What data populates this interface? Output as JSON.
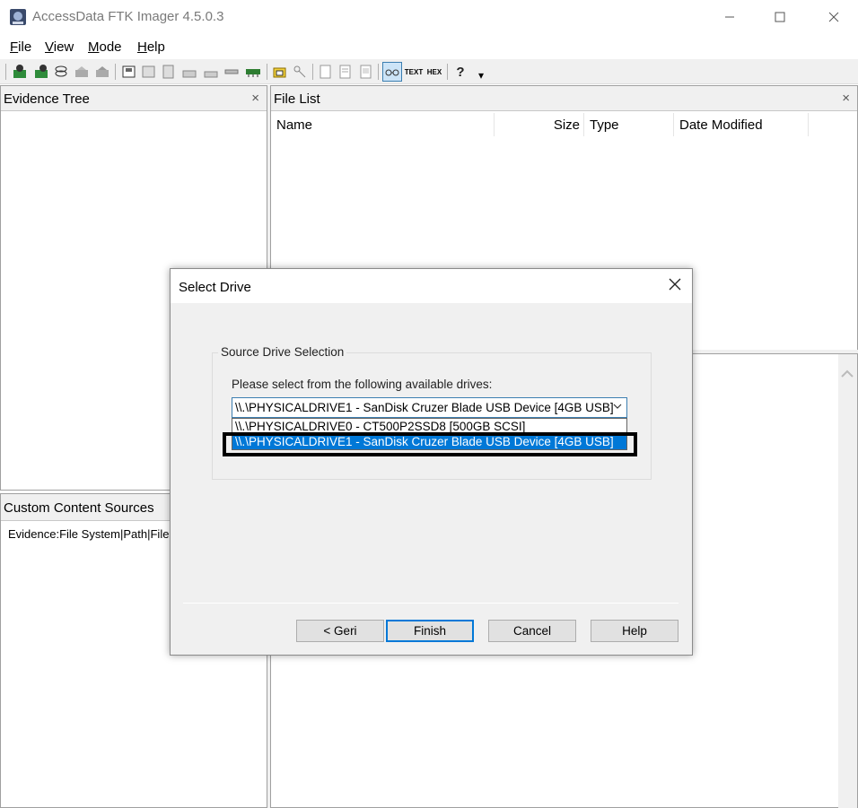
{
  "window": {
    "title": "AccessData FTK Imager 4.5.0.3",
    "minimize": "—",
    "maximize": "☐",
    "close": "✕"
  },
  "menu": [
    {
      "underline": "F",
      "rest": "ile"
    },
    {
      "underline": "V",
      "rest": "iew"
    },
    {
      "underline": "M",
      "rest": "ode"
    },
    {
      "underline": "H",
      "rest": "elp"
    }
  ],
  "toolbar": {
    "text_label": "TEXT",
    "hex_label": "HEX",
    "help_glyph": "?",
    "dropdown_glyph": "▾"
  },
  "evidence_tree": {
    "title": "Evidence Tree",
    "close": "×"
  },
  "file_list": {
    "title": "File List",
    "close": "×",
    "columns": [
      "Name",
      "Size",
      "Type",
      "Date Modified"
    ]
  },
  "custom_content": {
    "title": "Custom Content Sources",
    "columns_text": "Evidence:File System|Path|File"
  },
  "dialog": {
    "title": "Select Drive",
    "close": "✕",
    "group_label": "Source Drive Selection",
    "instruction": "Please select from the following available drives:",
    "selected_drive": "\\\\.\\PHYSICALDRIVE1 - SanDisk Cruzer Blade USB Device [4GB USB]",
    "combo_arrow": "⌵",
    "options": [
      "\\\\.\\PHYSICALDRIVE0 - CT500P2SSD8 [500GB SCSI]",
      "\\\\.\\PHYSICALDRIVE1 - SanDisk Cruzer Blade USB Device [4GB USB]"
    ],
    "buttons": {
      "back": "< Geri",
      "finish": "Finish",
      "cancel": "Cancel",
      "help": "Help"
    }
  }
}
